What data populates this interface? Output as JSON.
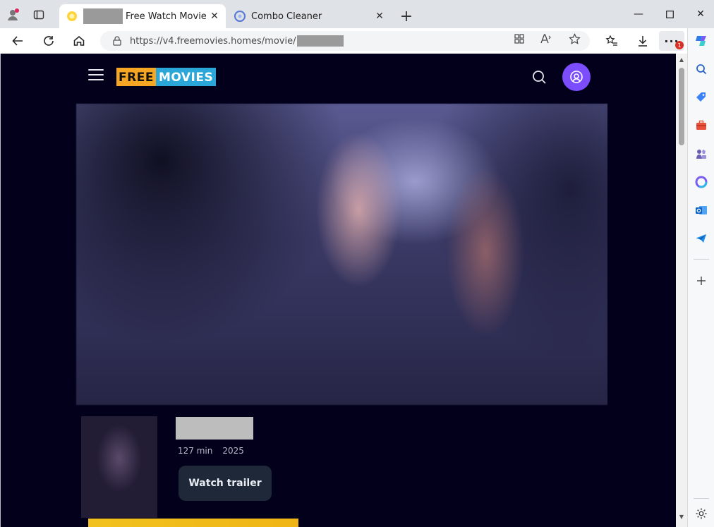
{
  "browser": {
    "tabs": [
      {
        "title": "Free Watch Movie —",
        "active": true
      },
      {
        "title": "Combo Cleaner",
        "active": false
      }
    ],
    "url": "https://v4.freemovies.homes/movie/",
    "notification_count": "1"
  },
  "site": {
    "logo_part1": "FREE",
    "logo_part2": "MOVIES",
    "colors": {
      "logo_orange": "#f6a623",
      "logo_blue": "#2aa7d8",
      "avatar": "#7c4dff",
      "page_bg": "#02001a"
    }
  },
  "movie": {
    "duration": "127 min",
    "year": "2025",
    "trailer_label": "Watch trailer"
  }
}
